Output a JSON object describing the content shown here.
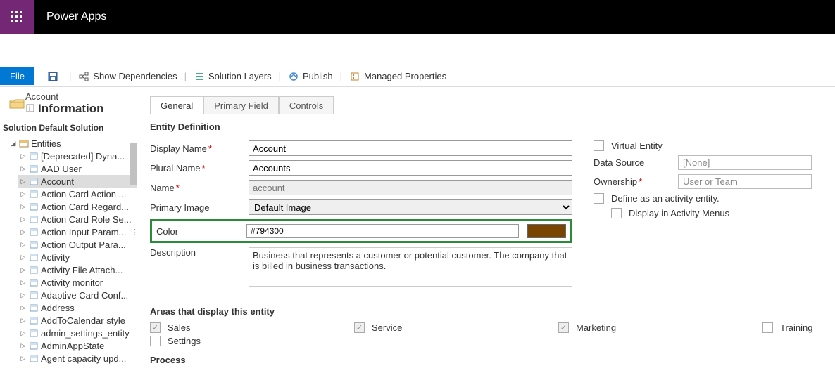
{
  "app": {
    "title": "Power Apps"
  },
  "toolbar": {
    "file": "File",
    "save_title": "Save",
    "show_deps": "Show Dependencies",
    "solution_layers": "Solution Layers",
    "publish": "Publish",
    "managed_props": "Managed Properties"
  },
  "entity_header": {
    "top": "Account",
    "title": "Information"
  },
  "solution_label": "Solution Default Solution",
  "tree": {
    "root": "Entities",
    "items": [
      "[Deprecated] Dyna...",
      "AAD User",
      "Account",
      "Action Card Action ...",
      "Action Card Regard...",
      "Action Card Role Se...",
      "Action Input Param...",
      "Action Output Para...",
      "Activity",
      "Activity File Attach...",
      "Activity monitor",
      "Adaptive Card Conf...",
      "Address",
      "AddToCalendar style",
      "admin_settings_entity",
      "AdminAppState",
      "Agent capacity upd..."
    ]
  },
  "tabs": {
    "general": "General",
    "primary_field": "Primary Field",
    "controls": "Controls"
  },
  "section": {
    "entity_def": "Entity Definition",
    "areas": "Areas that display this entity",
    "process": "Process"
  },
  "form": {
    "display_name_label": "Display Name",
    "display_name": "Account",
    "plural_name_label": "Plural Name",
    "plural_name": "Accounts",
    "name_label": "Name",
    "name": "account",
    "primary_image_label": "Primary Image",
    "primary_image": "Default Image",
    "color_label": "Color",
    "color_value": "#794300",
    "description_label": "Description",
    "description": "Business that represents a customer or potential customer. The company that is billed in business transactions."
  },
  "right": {
    "virtual_entity": "Virtual Entity",
    "data_source_label": "Data Source",
    "data_source_value": "[None]",
    "ownership_label": "Ownership",
    "ownership_value": "User or Team",
    "define_activity": "Define as an activity entity.",
    "display_activity_menus": "Display in Activity Menus"
  },
  "areas": {
    "sales": "Sales",
    "service": "Service",
    "marketing": "Marketing",
    "training": "Training",
    "settings": "Settings"
  }
}
